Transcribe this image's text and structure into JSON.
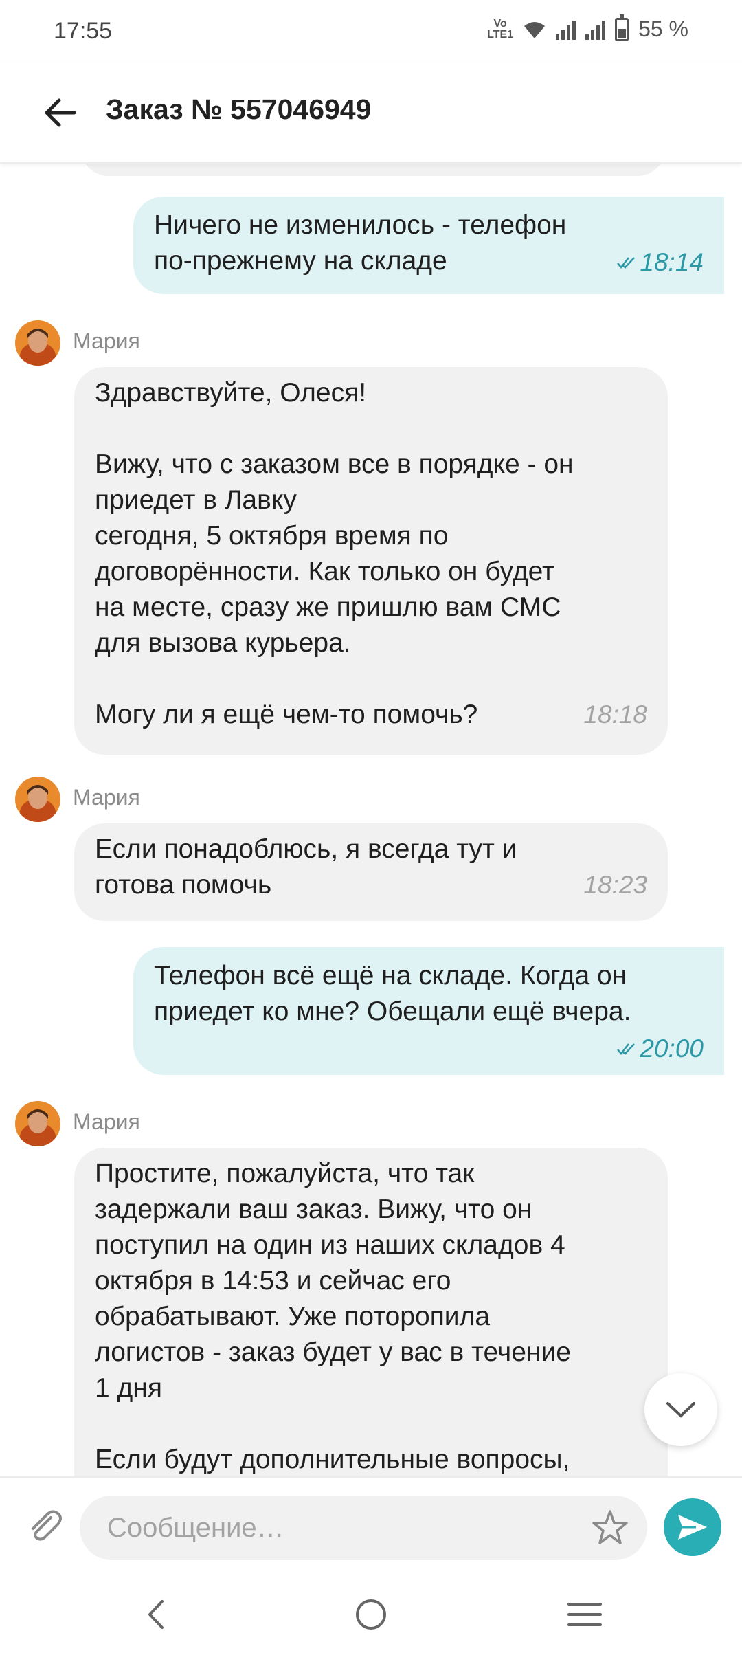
{
  "status_bar": {
    "time": "17:55",
    "lte_label": "VoLTE1",
    "battery": "55 %"
  },
  "header": {
    "title": "Заказ № 557046949"
  },
  "messages": [
    {
      "direction": "out",
      "text": "Ничего не изменилось - телефон\nпо-прежнему на складе",
      "time": "18:14",
      "status": "read"
    },
    {
      "direction": "in",
      "sender": "Мария",
      "text": "Здравствуйте, Олеся!\n\nВижу, что с заказом все в порядке - он\nприедет в Лавку\nсегодня, 5 октября время по\nдоговорённости. Как только он будет\nна месте, сразу же пришлю вам СМС\nдля вызова курьера.\n\nМогу ли я ещё чем-то помочь?",
      "time": "18:18"
    },
    {
      "direction": "in",
      "sender": "Мария",
      "text": "Если понадоблюсь, я всегда тут и\nготова помочь",
      "time": "18:23"
    },
    {
      "direction": "out",
      "text": "Телефон всё ещё на складе. Когда он\nприедет ко мне? Обещали ещё вчера.",
      "time": "20:00",
      "status": "read"
    },
    {
      "direction": "in",
      "sender": "Мария",
      "text": "Простите, пожалуйста, что так\nзадержали ваш заказ. Вижу, что он\nпоступил на один из наших складов 4\nоктября в 14:53 и сейчас его\nобрабатывают. Уже поторопила\nлогистов - заказ будет у вас в течение\n1 дня\n\nЕсли будут дополнительные вопросы,"
    }
  ],
  "composer": {
    "placeholder": "Сообщение…"
  },
  "icons": {
    "back": "arrow-left-icon",
    "attach": "paperclip-icon",
    "favorite": "star-icon",
    "send": "send-icon",
    "scroll_down": "chevron-down-icon",
    "read_receipt": "double-check-icon"
  },
  "colors": {
    "outgoing_bubble": "#dff2f4",
    "incoming_bubble": "#f1f1f1",
    "accent": "#2aaeb6",
    "outgoing_time": "#2b98a6"
  }
}
